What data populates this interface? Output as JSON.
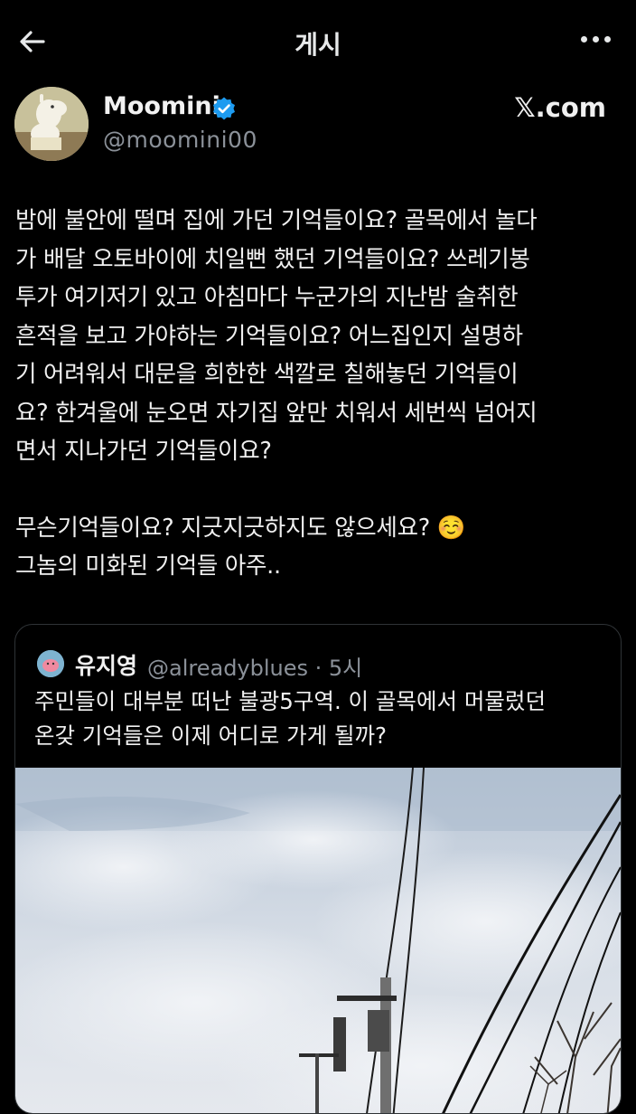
{
  "header": {
    "title": "게시"
  },
  "author": {
    "name": "Moomini",
    "handle": "@moomini00",
    "source": "𝕏.com"
  },
  "post": {
    "lines1": [
      "밤에 불안에 떨며 집에 가던 기억들이요? 골목에서 놀다",
      "가 배달 오토바이에 치일뻔 했던 기억들이요? 쓰레기봉",
      "투가 여기저기 있고 아침마다 누군가의 지난밤 술취한",
      "흔적을 보고 가야하는 기억들이요? 어느집인지 설명하",
      "기 어려워서 대문을 희한한 색깔로 칠해놓던 기억들이",
      "요? 한겨울에 눈오면 자기집 앞만 치워서 세번씩 넘어지",
      "면서 지나가던 기억들이요?"
    ],
    "lines2": [
      "무슨기억들이요? 지긋지긋하지도 않으세요? ☺️",
      "그놈의 미화된 기억들 아주.."
    ]
  },
  "quoted": {
    "name": "유지영",
    "handle_time": "@alreadyblues · 5시",
    "lines": [
      "주민들이 대부분 떠난 불광5구역. 이 골목에서 머물렀던",
      "온갖 기억들은 이제 어디로 가게 될까?"
    ]
  },
  "colors": {
    "background": "#000000",
    "text": "#e7e9ea",
    "muted": "#71767b",
    "verified": "#1d9bf0"
  },
  "icons": [
    "back-arrow-icon",
    "more-icon",
    "verified-badge-icon"
  ]
}
